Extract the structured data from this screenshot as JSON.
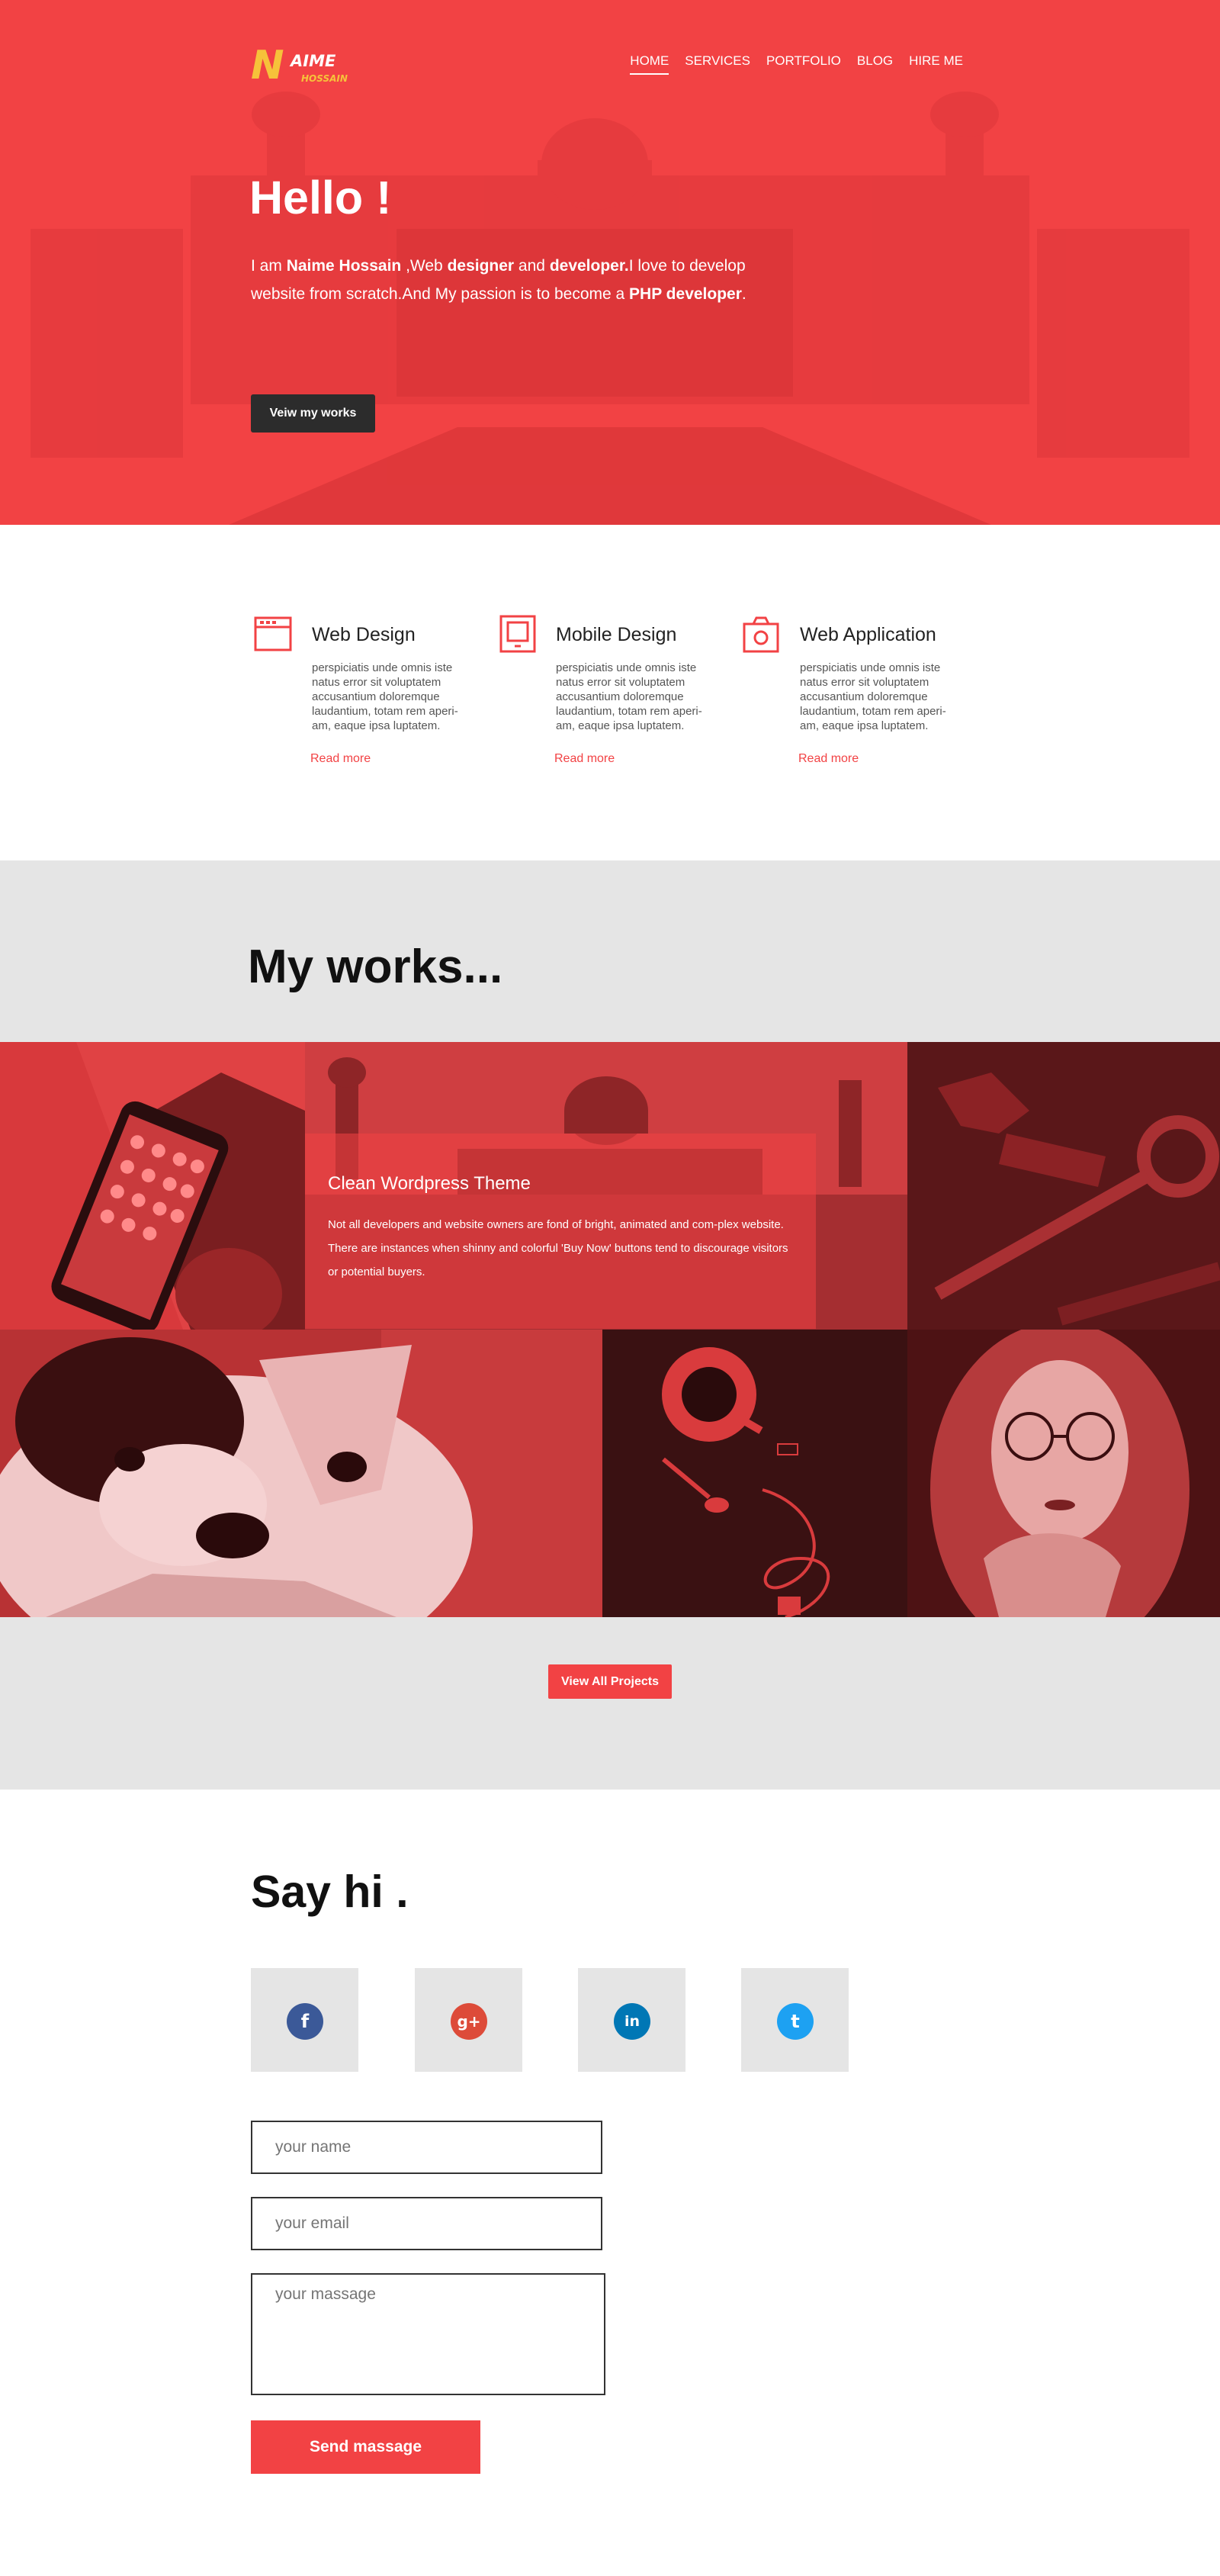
{
  "header": {
    "logo": {
      "initial": "N",
      "rest": "AIME",
      "sub": "HOSSAIN"
    },
    "nav": [
      {
        "label": "HOME",
        "active": true
      },
      {
        "label": "SERVICES",
        "active": false
      },
      {
        "label": "PORTFOLIO",
        "active": false
      },
      {
        "label": "BLOG",
        "active": false
      },
      {
        "label": "HIRE ME",
        "active": false
      }
    ]
  },
  "hero": {
    "title": "Hello !",
    "intro": {
      "t1": "I am ",
      "name": "Naime Hossain",
      "t2": " ,Web ",
      "b2": "designer",
      "t3": " and ",
      "b3": "developer.",
      "t4": "I love to develop website from scratch.And My passion is to become a ",
      "b4": "PHP developer",
      "t5": "."
    },
    "button": "Veiw my works"
  },
  "services": [
    {
      "icon": "browser-window-icon",
      "title": "Web Design",
      "text": "perspiciatis unde omnis iste natus error sit voluptatem accusantium doloremque laudantium, totam rem aperi-am, eaque ipsa luptatem.",
      "link": "Read more"
    },
    {
      "icon": "tablet-device-icon",
      "title": "Mobile Design",
      "text": "perspiciatis unde omnis iste natus error sit voluptatem accusantium doloremque laudantium, totam rem aperi-am, eaque ipsa luptatem.",
      "link": "Read more"
    },
    {
      "icon": "camera-icon",
      "title": "Web Application",
      "text": "perspiciatis unde omnis iste natus error sit voluptatem accusantium doloremque laudantium, totam rem aperi-am, eaque ipsa luptatem.",
      "link": "Read more"
    }
  ],
  "works": {
    "title": "My works...",
    "featured": {
      "title": "Clean Wordpress Theme",
      "text": "Not all developers and website owners are fond of bright, animated and com-plex website. There are instances when shinny and colorful 'Buy Now' buttons tend to discourage visitors or potential buyers."
    },
    "button": "View All Projects"
  },
  "contact": {
    "title": "Say hi .",
    "social": [
      {
        "name": "facebook",
        "glyph": "f",
        "color": "#3b5998"
      },
      {
        "name": "google-plus",
        "glyph": "g+",
        "color": "#dd4b39"
      },
      {
        "name": "linkedin",
        "glyph": "in",
        "color": "#0077b5"
      },
      {
        "name": "twitter",
        "glyph": "t",
        "color": "#1da1f2"
      }
    ],
    "form": {
      "name_placeholder": "your name",
      "email_placeholder": "your email",
      "message_placeholder": "your massage",
      "submit": "Send massage"
    }
  },
  "colors": {
    "accent": "#f24244",
    "dark": "#2c2c2c",
    "panel": "#e5e5e5",
    "logo_yellow": "#f6c23a"
  }
}
